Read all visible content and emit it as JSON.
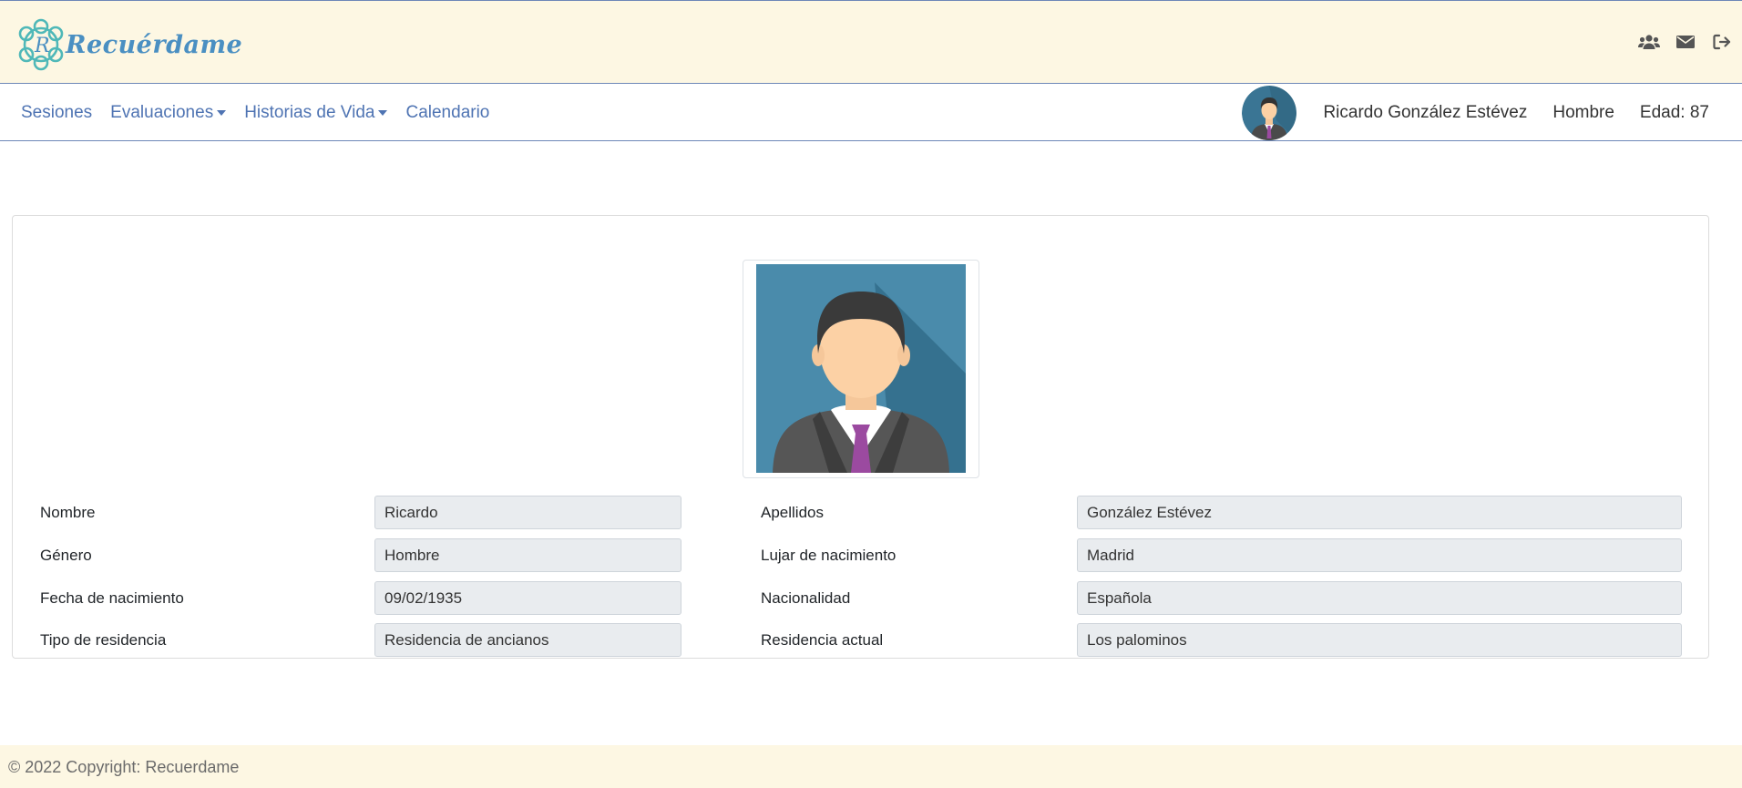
{
  "header": {
    "logo_text": "Recuérdame",
    "icons": [
      "users-icon",
      "envelope-icon",
      "sign-out-icon"
    ],
    "accent_color": "#4f74b3",
    "background_color": "#fdf7e3"
  },
  "nav": {
    "links": [
      {
        "label": "Sesiones"
      },
      {
        "label": "Evaluaciones"
      },
      {
        "label": "Historias de Vida"
      },
      {
        "label": "Calendario"
      }
    ],
    "patient_name": "Ricardo González Estévez",
    "patient_gender": "Hombre",
    "patient_age": "Edad: 87"
  },
  "profile": {
    "fields": [
      {
        "label": "Nombre",
        "value": "Ricardo"
      },
      {
        "label": "Apellidos",
        "value": "González Estévez"
      },
      {
        "label": "Género",
        "value": "Hombre"
      },
      {
        "label": "Lujar de nacimiento",
        "value": "Madrid"
      },
      {
        "label": "Fecha de nacimiento",
        "value": "09/02/1935"
      },
      {
        "label": "Nacionalidad",
        "value": "Española"
      },
      {
        "label": "Tipo de residencia",
        "value": "Residencia de ancianos"
      },
      {
        "label": "Residencia actual",
        "value": "Los palominos"
      }
    ]
  },
  "footer": {
    "copyright": "© 2022 Copyright: Recuerdame"
  }
}
